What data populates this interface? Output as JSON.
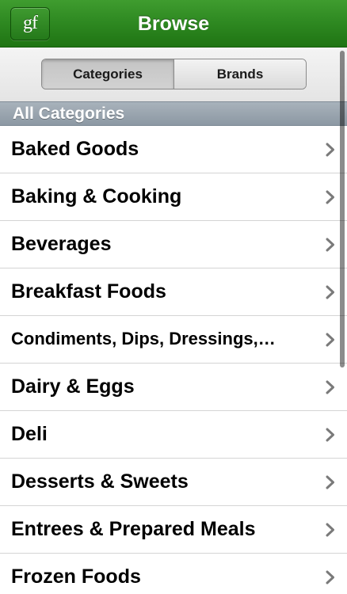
{
  "navbar": {
    "logo_text": "gf",
    "title": "Browse"
  },
  "segmented": {
    "categories_label": "Categories",
    "brands_label": "Brands",
    "selected": "Categories"
  },
  "section": {
    "title": "All Categories"
  },
  "categories": [
    "Baked Goods",
    "Baking & Cooking",
    "Beverages",
    "Breakfast Foods",
    "Condiments, Dips, Dressings,…",
    "Dairy & Eggs",
    "Deli",
    "Desserts & Sweets",
    "Entrees & Prepared Meals",
    "Frozen Foods"
  ],
  "icons": {
    "row_disclosure": "chevron-right-icon"
  },
  "colors": {
    "navbar_green": "#2f8a22",
    "section_header": "#98a3ad",
    "chevron": "#7a7a7a"
  }
}
